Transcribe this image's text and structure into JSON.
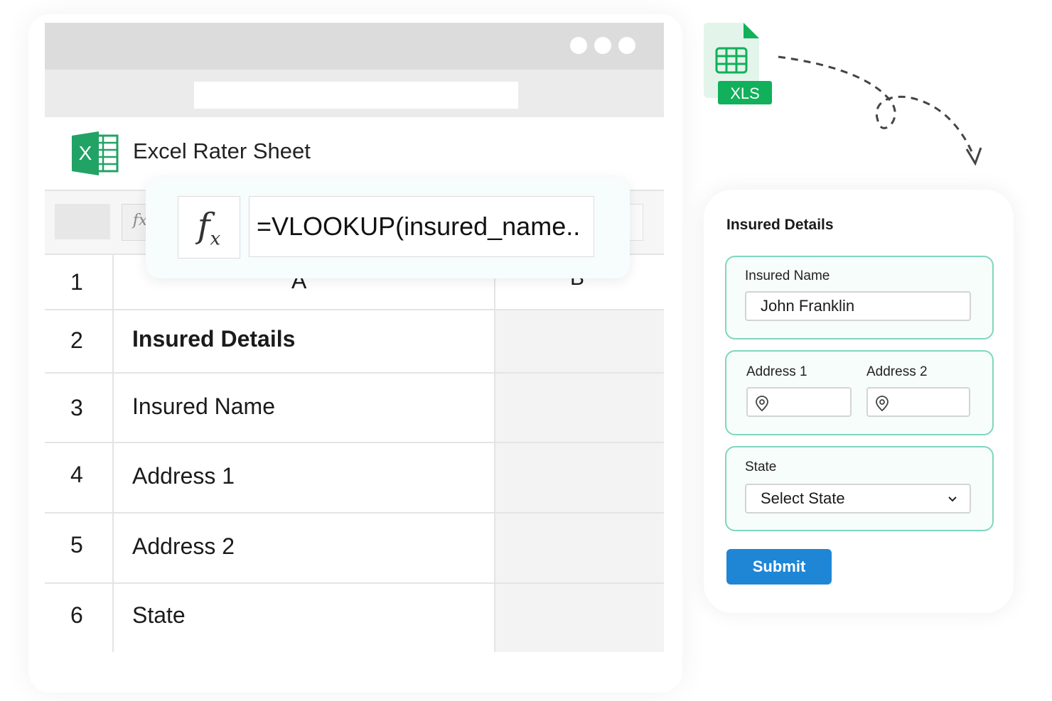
{
  "spreadsheet": {
    "title": "Excel Rater Sheet",
    "formula": "=VLOOKUP(insured_name..",
    "fx_symbol": "f",
    "fx_sub": "x",
    "fx_small": "fx",
    "logo_letter": "X",
    "columns": [
      "A",
      "B"
    ],
    "header_row_number": "1",
    "rows": [
      {
        "number": "2",
        "label": "Insured Details"
      },
      {
        "number": "3",
        "label": "Insured Name"
      },
      {
        "number": "4",
        "label": "Address 1"
      },
      {
        "number": "5",
        "label": "Address 2"
      },
      {
        "number": "6",
        "label": "State"
      }
    ]
  },
  "file_badge": {
    "label": "XLS",
    "color": "#11b05a"
  },
  "form": {
    "title": "Insured Details",
    "insured_name_label": "Insured Name",
    "insured_name_value": "John Franklin",
    "address1_label": "Address 1",
    "address2_label": "Address 2",
    "state_label": "State",
    "state_value": "Select State",
    "submit_label": "Submit"
  },
  "colors": {
    "accent": "#1f86d6",
    "group_border": "#7fd6be",
    "excel_green": "#21a366"
  },
  "icons": [
    "excel-logo-icon",
    "fx-icon",
    "spreadsheet-file-icon",
    "location-pin-icon",
    "chevron-down-icon",
    "dashed-arrow-icon"
  ]
}
